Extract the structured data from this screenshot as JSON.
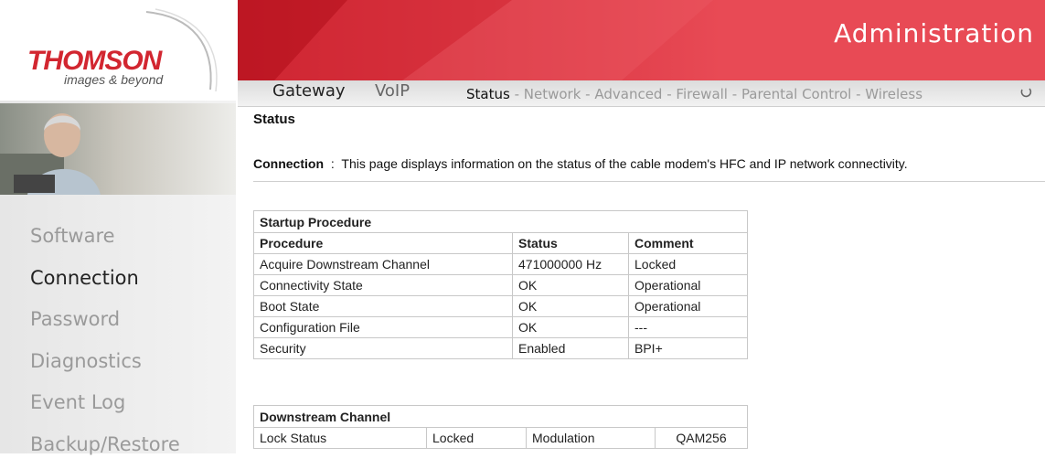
{
  "brand": {
    "name": "THOMSON",
    "tagline": "images & beyond"
  },
  "header": {
    "title": "Administration"
  },
  "tabs": [
    "Gateway",
    "VoIP"
  ],
  "submenu": [
    {
      "label": "Status",
      "active": true
    },
    {
      "label": "Network",
      "active": false
    },
    {
      "label": "Advanced",
      "active": false
    },
    {
      "label": "Firewall",
      "active": false
    },
    {
      "label": "Parental Control",
      "active": false
    },
    {
      "label": "Wireless",
      "active": false
    }
  ],
  "submenu_separator": " - ",
  "sidebar": {
    "items": [
      {
        "label": "Software",
        "active": false
      },
      {
        "label": "Connection",
        "active": true
      },
      {
        "label": "Password",
        "active": false
      },
      {
        "label": "Diagnostics",
        "active": false
      },
      {
        "label": "Event Log",
        "active": false
      },
      {
        "label": "Backup/Restore",
        "active": false
      }
    ]
  },
  "page": {
    "title": "Status",
    "desc_label": "Connection",
    "desc_sep": ":",
    "desc_text": "This page displays information on the status of the cable modem's HFC and IP network connectivity."
  },
  "startup_table": {
    "caption": "Startup Procedure",
    "headers": [
      "Procedure",
      "Status",
      "Comment"
    ],
    "rows": [
      [
        "Acquire Downstream Channel",
        "471000000 Hz",
        "Locked"
      ],
      [
        "Connectivity State",
        "OK",
        "Operational"
      ],
      [
        "Boot State",
        "OK",
        "Operational"
      ],
      [
        "Configuration File",
        "OK",
        "---"
      ],
      [
        "Security",
        "Enabled",
        "BPI+"
      ]
    ]
  },
  "downstream_table": {
    "caption": "Downstream Channel",
    "rows": [
      [
        "Lock Status",
        "Locked",
        "Modulation",
        "QAM256"
      ]
    ]
  },
  "colors": {
    "brand_red": "#d22630",
    "banner_red": "#e84a55"
  }
}
